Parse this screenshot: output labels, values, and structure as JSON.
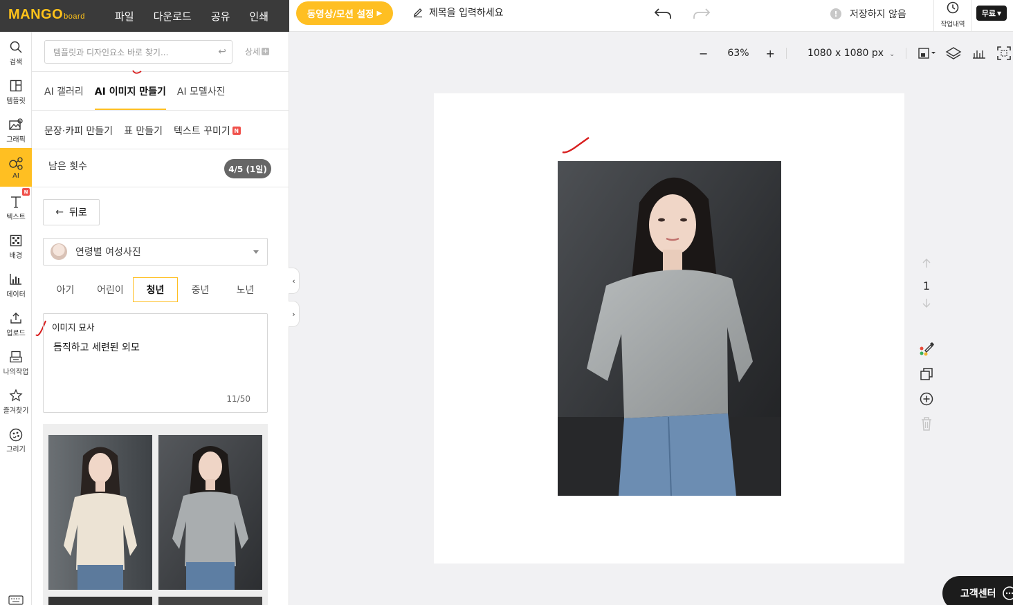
{
  "app": {
    "logo_main": "MANGO",
    "logo_sub": "board",
    "menu": [
      "파일",
      "다운로드",
      "공유",
      "인쇄"
    ],
    "motion_button": "동영상/모션 설정",
    "title_placeholder": "제목을 입력하세요",
    "save_status": "저장하지 않음",
    "history_label": "작업내역",
    "plan_label": "무료"
  },
  "rail": [
    {
      "label": "검색",
      "icon": "search-icon"
    },
    {
      "label": "템플릿",
      "icon": "template-icon"
    },
    {
      "label": "그래픽",
      "icon": "graphic-icon"
    },
    {
      "label": "AI",
      "icon": "ai-icon",
      "active": true
    },
    {
      "label": "텍스트",
      "icon": "text-icon",
      "badge": "N"
    },
    {
      "label": "배경",
      "icon": "background-icon"
    },
    {
      "label": "데이터",
      "icon": "data-icon"
    },
    {
      "label": "업로드",
      "icon": "upload-icon"
    },
    {
      "label": "나의작업",
      "icon": "my-work-icon"
    },
    {
      "label": "즐겨찾기",
      "icon": "star-icon"
    },
    {
      "label": "그리기",
      "icon": "draw-icon"
    }
  ],
  "panel": {
    "search_placeholder": "템플릿과 디자인요소 바로 찾기...",
    "detail_label": "상세",
    "tabs": [
      "AI 갤러리",
      "AI 이미지 만들기",
      "AI 모델사진"
    ],
    "active_tab": 1,
    "subtabs": [
      "문장·카피 만들기",
      "표 만들기",
      "텍스트 꾸미기"
    ],
    "subtab_badge": "N",
    "remain_label": "남은 횟수",
    "remain_value": "4/5 (1일)",
    "back_label": "뒤로",
    "category_value": "연령별 여성사진",
    "ages": [
      "아기",
      "어린이",
      "청년",
      "중년",
      "노년"
    ],
    "active_age": 2,
    "description_label": "이미지 묘사",
    "description_value": "듬직하고 세련된 외모",
    "description_count": "11/50"
  },
  "canvas": {
    "zoom": "63%",
    "size": "1080 x 1080 px",
    "page_number": "1"
  },
  "support_label": "고객센터",
  "colors": {
    "accent": "#ffbf22",
    "topbar_dark": "#3a3a3a",
    "badge_red": "#f0504a"
  }
}
